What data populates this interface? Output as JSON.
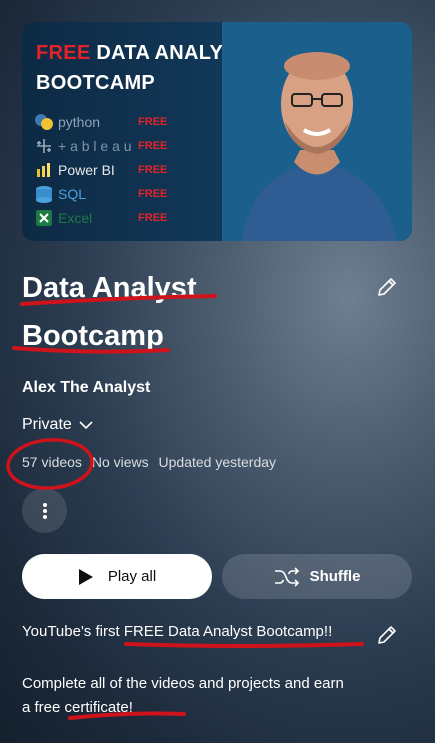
{
  "thumbnail": {
    "title_free": "FREE",
    "title_rest": " DATA ANALYST",
    "title_line2": "BOOTCAMP",
    "tools": [
      {
        "icon": "python-icon",
        "name": "python",
        "badge": "FREE",
        "color": "#8fa3b8"
      },
      {
        "icon": "tableau-icon",
        "name": "+ a b l e a u",
        "badge": "FREE",
        "color": "#7d93aa"
      },
      {
        "icon": "powerbi-icon",
        "name": "Power BI",
        "badge": "FREE",
        "color": "#e8e8e8"
      },
      {
        "icon": "sql-icon",
        "name": "SQL",
        "badge": "FREE",
        "color": "#4aa3df"
      },
      {
        "icon": "excel-icon",
        "name": "Excel",
        "badge": "FREE",
        "color": "#1e7a45"
      }
    ]
  },
  "playlist": {
    "title": "Data Analyst Bootcamp",
    "author": "Alex The Analyst",
    "privacy": "Private",
    "video_count": "57 videos",
    "views": "No views",
    "updated": "Updated yesterday"
  },
  "actions": {
    "play_all": "Play all",
    "shuffle": "Shuffle"
  },
  "description": {
    "line1_prefix": "YouTube's first ",
    "line1_highlight": "FREE Data Analyst Bootcamp!!",
    "line2": "Complete all of the videos and projects and earn a ",
    "line2_highlight": "free certificate!"
  },
  "colors": {
    "annotation": "#d0121b",
    "free_red": "#e2242a"
  }
}
